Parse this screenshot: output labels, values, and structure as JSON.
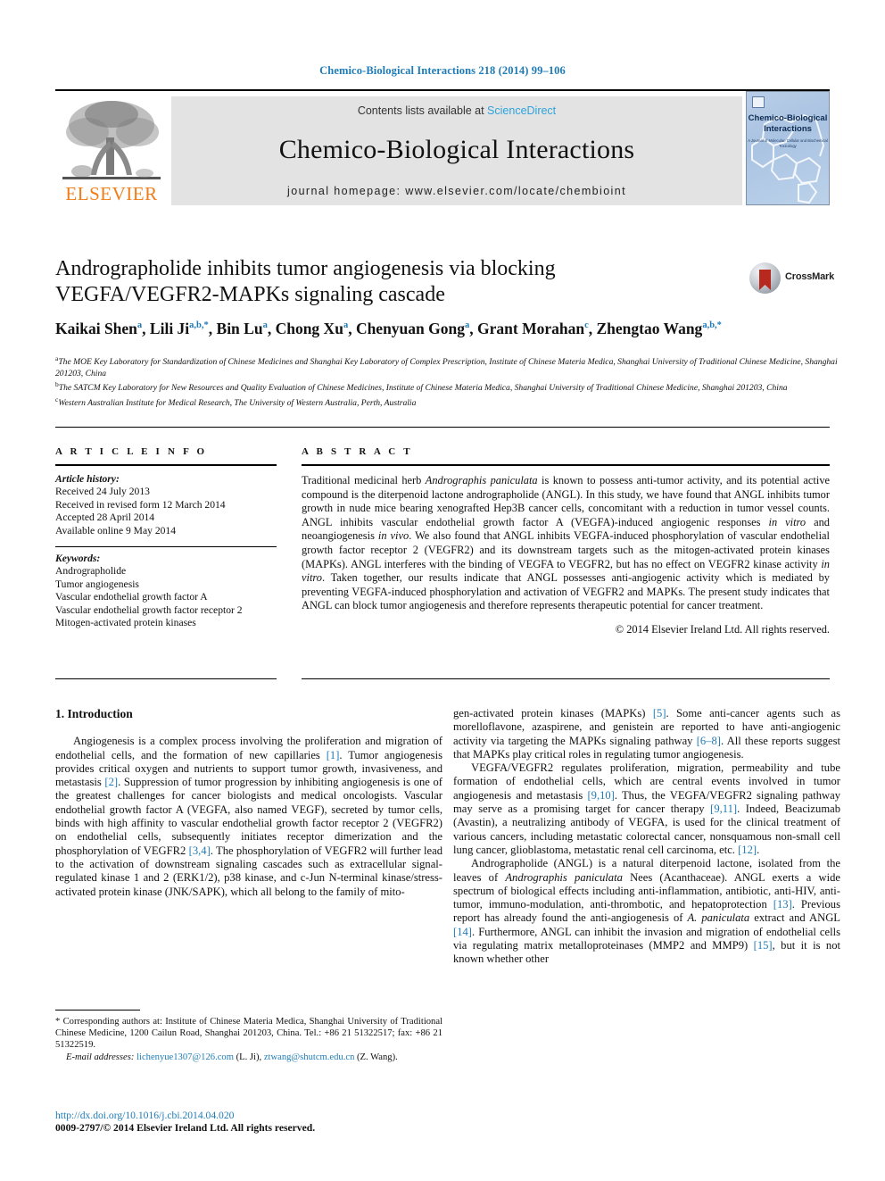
{
  "running_head": "Chemico-Biological Interactions 218 (2014) 99–106",
  "masthead": {
    "publisher_name": "ELSEVIER",
    "contents_prefix": "Contents lists available at ",
    "contents_link": "ScienceDirect",
    "journal_title": "Chemico-Biological Interactions",
    "homepage": "journal homepage: www.elsevier.com/locate/chembioint",
    "cover": {
      "title_line1": "Chemico-Biological",
      "title_line2": "Interactions",
      "subtitle": "A Journal of Molecular, Cellular and Biochemical Toxicology"
    }
  },
  "article": {
    "title_line1": "Andrographolide inhibits tumor angiogenesis via blocking",
    "title_line2": "VEGFA/VEGFR2-MAPKs signaling cascade",
    "crossmark_label": "CrossMark",
    "authors": [
      {
        "name": "Kaikai Shen",
        "sup": "a"
      },
      {
        "name": "Lili Ji",
        "sup": "a,b,*"
      },
      {
        "name": "Bin Lu",
        "sup": "a"
      },
      {
        "name": "Chong Xu",
        "sup": "a"
      },
      {
        "name": "Chenyuan Gong",
        "sup": "a"
      },
      {
        "name": "Grant Morahan",
        "sup": "c"
      },
      {
        "name": "Zhengtao Wang",
        "sup": "a,b,*"
      }
    ],
    "affiliations": [
      {
        "mark": "a",
        "text": "The MOE Key Laboratory for Standardization of Chinese Medicines and Shanghai Key Laboratory of Complex Prescription, Institute of Chinese Materia Medica, Shanghai University of Traditional Chinese Medicine, Shanghai 201203, China"
      },
      {
        "mark": "b",
        "text": "The SATCM Key Laboratory for New Resources and Quality Evaluation of Chinese Medicines, Institute of Chinese Materia Medica, Shanghai University of Traditional Chinese Medicine, Shanghai 201203, China"
      },
      {
        "mark": "c",
        "text": "Western Australian Institute for Medical Research, The University of Western Australia, Perth, Australia"
      }
    ]
  },
  "article_info": {
    "heading": "A R T I C L E   I N F O",
    "history_label": "Article history:",
    "history": [
      "Received 24 July 2013",
      "Received in revised form 12 March 2014",
      "Accepted 28 April 2014",
      "Available online 9 May 2014"
    ],
    "keywords_label": "Keywords:",
    "keywords": [
      "Andrographolide",
      "Tumor angiogenesis",
      "Vascular endothelial growth factor A",
      "Vascular endothelial growth factor receptor 2",
      "Mitogen-activated protein kinases"
    ]
  },
  "abstract": {
    "heading": "A B S T R A C T",
    "part1": "Traditional medicinal herb ",
    "italic1": "Andrographis paniculata",
    "part2": " is known to possess anti-tumor activity, and its potential active compound is the diterpenoid lactone andrographolide (ANGL). In this study, we have found that ANGL inhibits tumor growth in nude mice bearing xenografted Hep3B cancer cells, concomitant with a reduction in tumor vessel counts. ANGL inhibits vascular endothelial growth factor A (VEGFA)-induced angiogenic responses ",
    "italic2": "in vitro",
    "part3": " and neoangiogenesis ",
    "italic3": "in vivo",
    "part4": ". We also found that ANGL inhibits VEGFA-induced phosphorylation of vascular endothelial growth factor receptor 2 (VEGFR2) and its downstream targets such as the mitogen-activated protein kinases (MAPKs). ANGL interferes with the binding of VEGFA to VEGFR2, but has no effect on VEGFR2 kinase activity ",
    "italic4": "in vitro",
    "part5": ". Taken together, our results indicate that ANGL possesses anti-angiogenic activity which is mediated by preventing VEGFA-induced phosphorylation and activation of VEGFR2 and MAPKs. The present study indicates that ANGL can block tumor angiogenesis and therefore represents therapeutic potential for cancer treatment.",
    "copyright": "© 2014 Elsevier Ireland Ltd. All rights reserved."
  },
  "introduction": {
    "heading": "1. Introduction",
    "left": {
      "p1_a": "Angiogenesis is a complex process involving the proliferation and migration of endothelial cells, and the formation of new capillaries ",
      "r1": "[1]",
      "p1_b": ". Tumor angiogenesis provides critical oxygen and nutrients to support tumor growth, invasiveness, and metastasis ",
      "r2": "[2]",
      "p1_c": ". Suppression of tumor progression by inhibiting angiogenesis is one of the greatest challenges for cancer biologists and medical oncologists. Vascular endothelial growth factor A (VEGFA, also named VEGF), secreted by tumor cells, binds with high affinity to vascular endothelial growth factor receptor 2 (VEGFR2) on endothelial cells, subsequently initiates receptor dimerization and the phosphorylation of VEGFR2 ",
      "r3": "[3,4]",
      "p1_d": ". The phosphorylation of VEGFR2 will further lead to the activation of downstream signaling cascades such as extracellular signal-regulated kinase 1 and 2 (ERK1/2), p38 kinase, and c-Jun N-terminal kinase/stress-activated protein kinase (JNK/SAPK), which all belong to the family of mito-"
    },
    "right": {
      "p1_cont_a": "gen-activated protein kinases (MAPKs) ",
      "r5": "[5]",
      "p1_cont_b": ". Some anti-cancer agents such as morelloflavone, azaspirene, and genistein are reported to have anti-angiogenic activity via targeting the MAPKs signaling pathway ",
      "r68": "[6–8]",
      "p1_cont_c": ". All these reports suggest that MAPKs play critical roles in regulating tumor angiogenesis.",
      "p2_a": "VEGFA/VEGFR2 regulates proliferation, migration, permeability and tube formation of endothelial cells, which are central events involved in tumor angiogenesis and metastasis ",
      "r910": "[9,10]",
      "p2_b": ". Thus, the VEGFA/VEGFR2 signaling pathway may serve as a promising target for cancer therapy ",
      "r911": "[9,11]",
      "p2_c": ". Indeed, Beacizumab (Avastin), a neutralizing antibody of VEGFA, is used for the clinical treatment of various cancers, including metastatic colorectal cancer, nonsquamous non-small cell lung cancer, glioblastoma, metastatic renal cell carcinoma, etc. ",
      "r12": "[12]",
      "p2_d": ".",
      "p3_a": "Andrographolide (ANGL) is a natural diterpenoid lactone, isolated from the leaves of ",
      "i1": "Andrographis paniculata",
      "p3_b": " Nees (Acanthaceae). ANGL exerts a wide spectrum of biological effects including anti-inflammation, antibiotic, anti-HIV, anti-tumor, immuno-modulation, anti-thrombotic, and hepatoprotection ",
      "r13": "[13]",
      "p3_c": ". Previous report has already found the anti-angiogenesis of ",
      "i2": "A. paniculata",
      "p3_d": " extract and ANGL ",
      "r14": "[14]",
      "p3_e": ". Furthermore, ANGL can inhibit the invasion and migration of endothelial cells via regulating matrix metalloproteinases (MMP2 and MMP9) ",
      "r15": "[15]",
      "p3_f": ", but it is not known whether other"
    }
  },
  "footnote": {
    "line1": "* Corresponding authors at: Institute of Chinese Materia Medica, Shanghai University of Traditional Chinese Medicine, 1200 Cailun Road, Shanghai 201203, China. Tel.: +86 21 51322517; fax: +86 21 51322519.",
    "email_label": "E-mail addresses:",
    "email1": "lichenyue1307@126.com",
    "email1_owner": "(L. Ji),",
    "email2": "ztwang@shutcm.edu.cn",
    "email2_owner": "(Z. Wang)."
  },
  "footer": {
    "doi": "http://dx.doi.org/10.1016/j.cbi.2014.04.020",
    "issn_line": "0009-2797/© 2014 Elsevier Ireland Ltd. All rights reserved."
  },
  "colors": {
    "link_blue": "#1f7bb6",
    "sciencedirect_blue": "#2ea3dd",
    "elsevier_orange": "#f07d18",
    "banner_grey": "#e3e3e3",
    "crossmark_red": "#b7291f"
  }
}
